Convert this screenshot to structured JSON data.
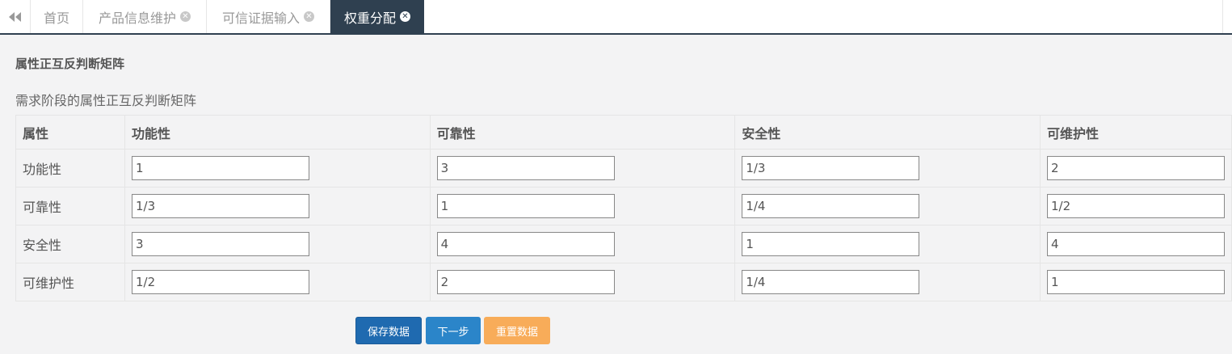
{
  "tabs": {
    "back_icon": "double-left-arrow-icon",
    "items": [
      {
        "label": "首页",
        "closable": false
      },
      {
        "label": "产品信息维护",
        "closable": true
      },
      {
        "label": "可信证据输入",
        "closable": true
      },
      {
        "label": "权重分配",
        "closable": true,
        "active": true
      }
    ],
    "close_glyph": "✕"
  },
  "section": {
    "title": "属性正互反判断矩阵",
    "subtitle": "需求阶段的属性正互反判断矩阵"
  },
  "matrix": {
    "headers": [
      "属性",
      "功能性",
      "可靠性",
      "安全性",
      "可维护性"
    ],
    "rows": [
      {
        "label": "功能性",
        "values": [
          "1",
          "3",
          "1/3",
          "2"
        ]
      },
      {
        "label": "可靠性",
        "values": [
          "1/3",
          "1",
          "1/4",
          "1/2"
        ]
      },
      {
        "label": "安全性",
        "values": [
          "3",
          "4",
          "1",
          "4"
        ]
      },
      {
        "label": "可维护性",
        "values": [
          "1/2",
          "2",
          "1/4",
          "1"
        ]
      }
    ]
  },
  "actions": {
    "save_label": "保存数据",
    "next_label": "下一步",
    "reset_label": "重置数据"
  },
  "colors": {
    "active_tab": "#2f4050",
    "save_button": "#1f6ab0",
    "next_button": "#2b85c9",
    "reset_button": "#f8ac59"
  }
}
